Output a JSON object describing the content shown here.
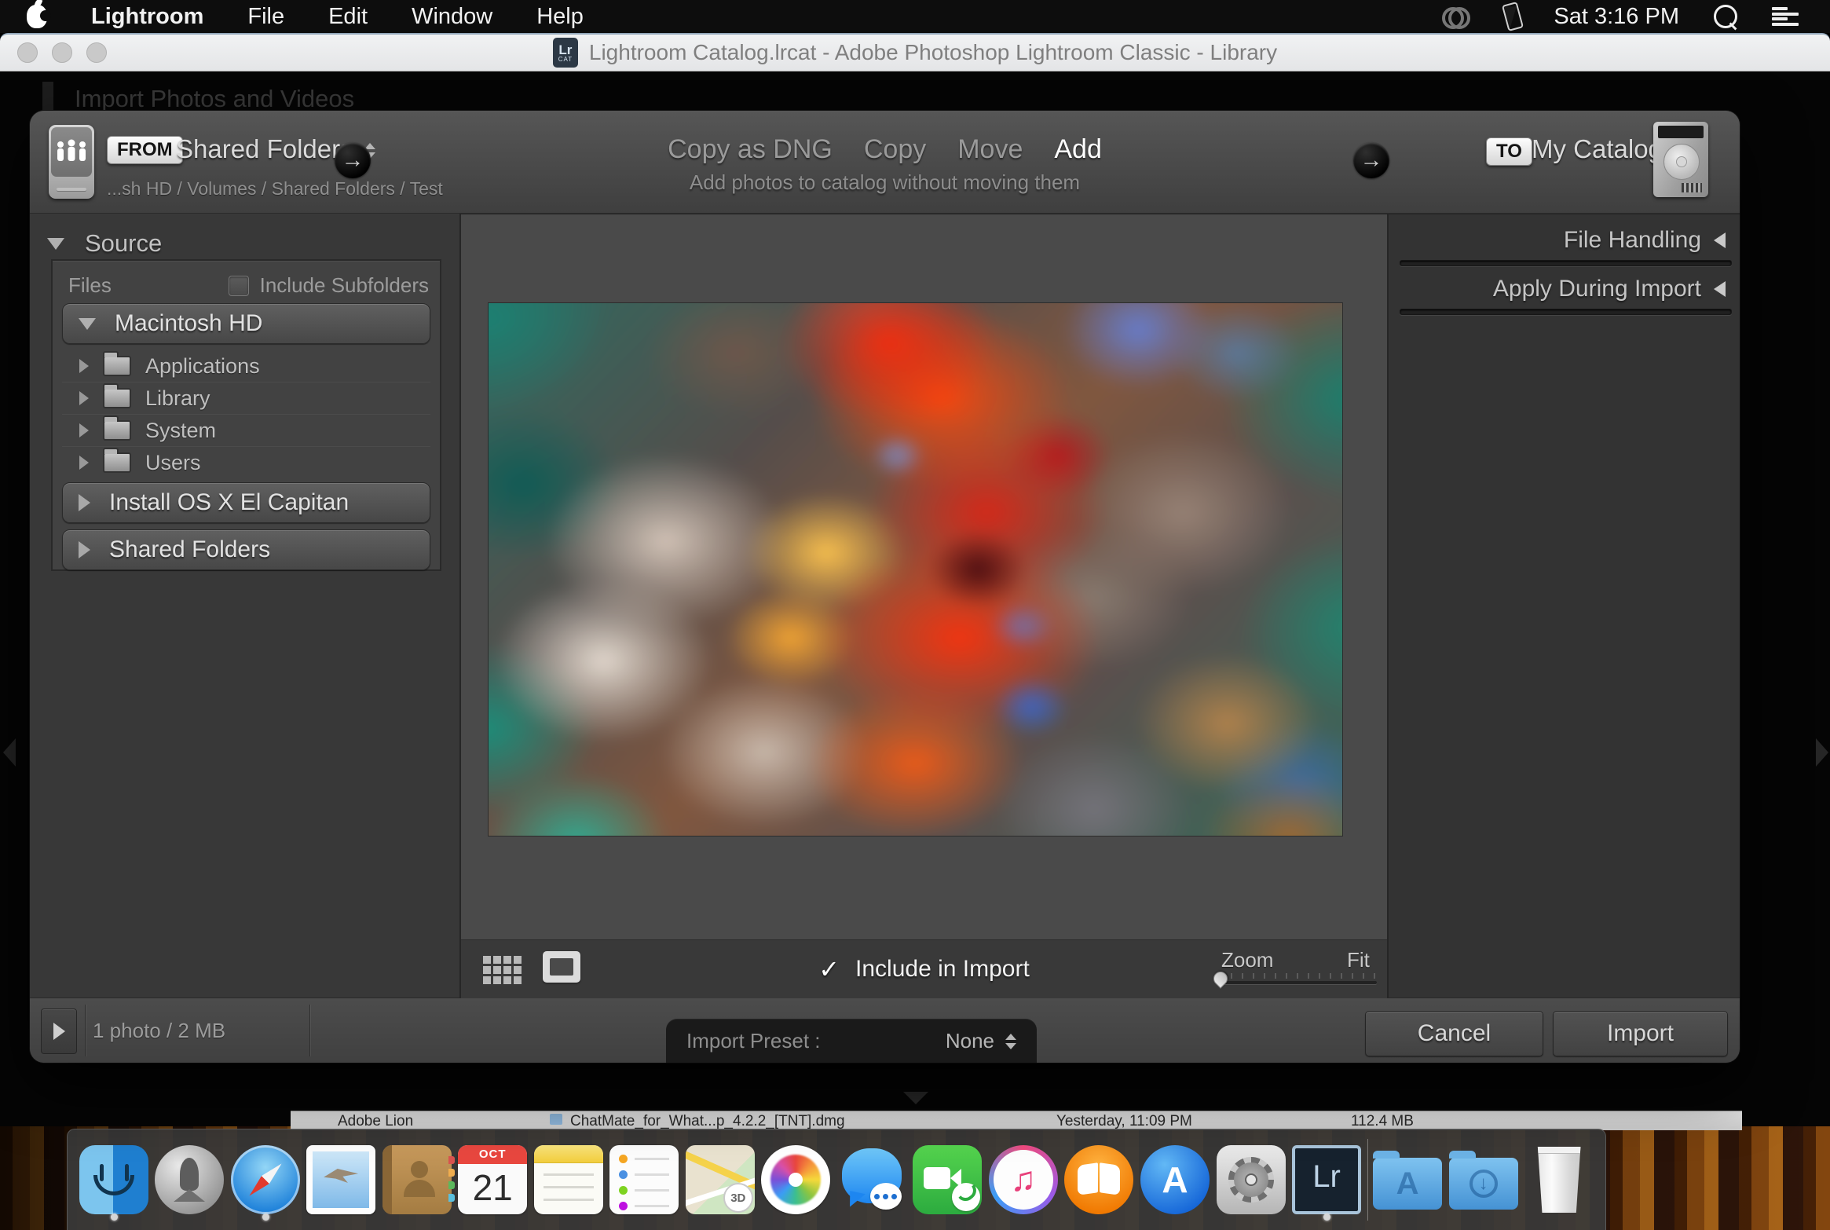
{
  "menubar": {
    "app": "Lightroom",
    "items": [
      "File",
      "Edit",
      "Window",
      "Help"
    ],
    "clock": "Sat 3:16 PM"
  },
  "titlebar": {
    "title": "Lightroom Catalog.lrcat - Adobe Photoshop Lightroom Classic - Library",
    "doc_icon": {
      "line1": "Lr",
      "line2": "CAT"
    }
  },
  "background": {
    "window_title": "Import Photos and Videos",
    "finder_row": {
      "folder": "Adobe Lion",
      "file": "ChatMate_for_What...p_4.2.2_[TNT].dmg",
      "modified": "Yesterday, 11:09 PM",
      "size": "112.4 MB"
    }
  },
  "import_dialog": {
    "from": {
      "badge": "FROM",
      "source": "Shared Folders",
      "path": "...sh HD / Volumes / Shared Folders / Test"
    },
    "methods": {
      "options": [
        "Copy as DNG",
        "Copy",
        "Move",
        "Add"
      ],
      "selected": "Add",
      "description": "Add photos to catalog without moving them"
    },
    "to": {
      "badge": "TO",
      "destination": "My Catalog"
    },
    "arrow_glyph": "→",
    "source_panel": {
      "header": "Source",
      "files_label": "Files",
      "include_subfolders_label": "Include Subfolders",
      "include_subfolders_checked": false,
      "volume": "Macintosh HD",
      "folders": [
        "Applications",
        "Library",
        "System",
        "Users"
      ],
      "other_volumes": [
        "Install OS X El Capitan",
        "Shared Folders"
      ]
    },
    "right_panel": {
      "sections": [
        "File Handling",
        "Apply During Import"
      ]
    },
    "preview_toolbar": {
      "check_glyph": "✓",
      "include_label": "Include in Import",
      "include_checked": true,
      "zoom_label": "Zoom",
      "fit_label": "Fit"
    },
    "bottom_bar": {
      "play_glyph": "▶",
      "status": "1 photo / 2 MB",
      "preset_label": "Import Preset :",
      "preset_value": "None",
      "cancel": "Cancel",
      "import": "Import"
    }
  },
  "dock": {
    "items": [
      {
        "name": "finder",
        "running": true
      },
      {
        "name": "launchpad",
        "running": false
      },
      {
        "name": "safari",
        "running": true
      },
      {
        "name": "mail",
        "running": false
      },
      {
        "name": "contacts",
        "running": false
      },
      {
        "name": "calendar",
        "running": false
      },
      {
        "name": "notes",
        "running": false
      },
      {
        "name": "reminders",
        "running": false
      },
      {
        "name": "maps",
        "running": false
      },
      {
        "name": "photos",
        "running": false
      },
      {
        "name": "messages",
        "running": false
      },
      {
        "name": "facetime",
        "running": false
      },
      {
        "name": "itunes",
        "running": false
      },
      {
        "name": "ibooks",
        "running": false
      },
      {
        "name": "app-store",
        "running": false
      },
      {
        "name": "system-preferences",
        "running": false
      },
      {
        "name": "lightroom",
        "running": true
      },
      {
        "name": "applications-folder",
        "running": false
      },
      {
        "name": "downloads-folder",
        "running": false
      },
      {
        "name": "trash",
        "running": false
      }
    ],
    "calendar_month": "OCT",
    "calendar_day": "21",
    "maps_badge": "3D",
    "appstore_letter": "A",
    "lightroom_label": "Lr",
    "downloads_arrow": "↓"
  },
  "colors": {
    "menubar_bg": "#0d0d0d",
    "titlebar_bg": "#ececec",
    "dialog_bg": "#3e3e3e",
    "selected_method": "#ffffff",
    "preset_bar_bg": "#1a1a1a",
    "calendar_red": "#e8473f",
    "folder_blue": "#5aa5e0"
  }
}
